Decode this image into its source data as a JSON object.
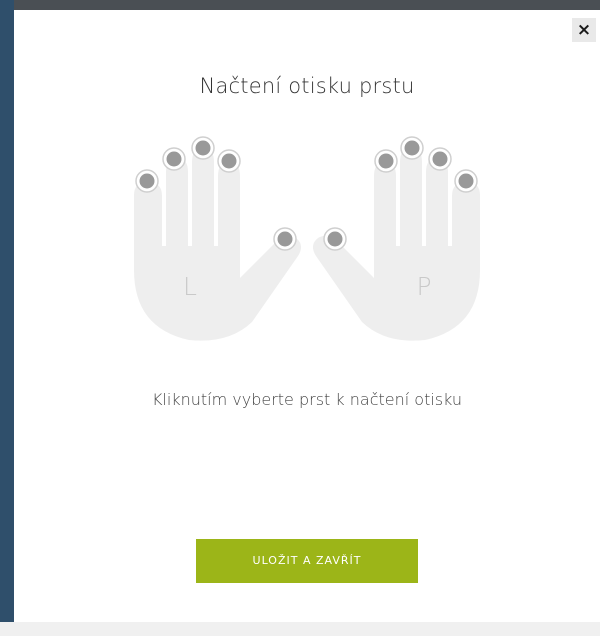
{
  "dialog": {
    "title": "Načtení otisku prstu",
    "close_label": "×",
    "instruction": "Kliknutím vyberte prst k načtení otisku",
    "save_label": "ULOŽIT A ZAVŘÍT"
  },
  "hands": {
    "left_label": "L",
    "right_label": "P"
  },
  "colors": {
    "accent": "#9cb518",
    "hand_fill": "#eeeeee",
    "finger_dot": "#999999"
  }
}
